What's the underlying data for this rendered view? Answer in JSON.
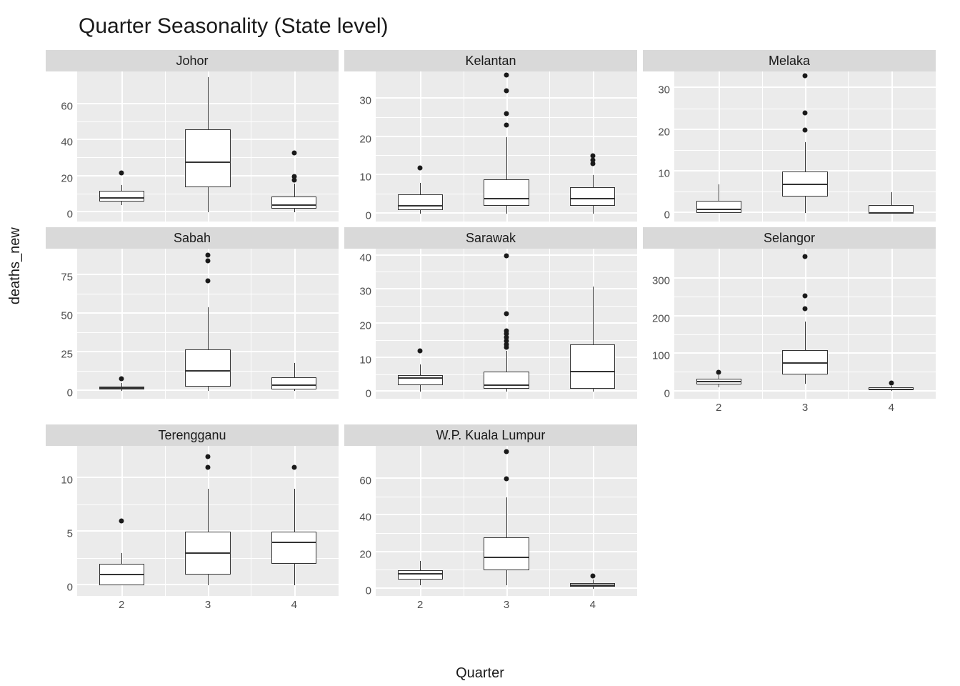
{
  "title": "Quarter Seasonality (State level)",
  "ylabel": "deaths_new",
  "xlabel": "Quarter",
  "categories": [
    "2",
    "3",
    "4"
  ],
  "chart_data": [
    {
      "name": "Johor",
      "ymin": -5,
      "ymax": 78,
      "yticks": [
        0,
        20,
        40,
        60
      ],
      "type": "box",
      "quarters": {
        "2": {
          "ymin": 4,
          "q1": 6,
          "median": 8,
          "q3": 12,
          "ymax": 15,
          "outliers": [
            22
          ]
        },
        "3": {
          "ymin": 0,
          "q1": 14,
          "median": 28,
          "q3": 46,
          "ymax": 75,
          "outliers": []
        },
        "4": {
          "ymin": 0,
          "q1": 2,
          "median": 4,
          "q3": 9,
          "ymax": 16,
          "outliers": [
            18,
            20,
            33
          ]
        }
      }
    },
    {
      "name": "Kelantan",
      "ymin": -2,
      "ymax": 37,
      "yticks": [
        0,
        10,
        20,
        30
      ],
      "type": "box",
      "quarters": {
        "2": {
          "ymin": 0,
          "q1": 1,
          "median": 2,
          "q3": 5,
          "ymax": 8,
          "outliers": [
            12
          ]
        },
        "3": {
          "ymin": 0,
          "q1": 2,
          "median": 4,
          "q3": 9,
          "ymax": 20,
          "outliers": [
            23,
            26,
            32,
            36
          ]
        },
        "4": {
          "ymin": 0,
          "q1": 2,
          "median": 4,
          "q3": 7,
          "ymax": 10,
          "outliers": [
            13,
            14,
            15
          ]
        }
      }
    },
    {
      "name": "Melaka",
      "ymin": -2,
      "ymax": 34,
      "yticks": [
        0,
        10,
        20,
        30
      ],
      "type": "box",
      "quarters": {
        "2": {
          "ymin": 0,
          "q1": 0,
          "median": 1,
          "q3": 3,
          "ymax": 7,
          "outliers": []
        },
        "3": {
          "ymin": 0,
          "q1": 4,
          "median": 7,
          "q3": 10,
          "ymax": 17,
          "outliers": [
            20,
            24,
            33
          ]
        },
        "4": {
          "ymin": 0,
          "q1": 0,
          "median": 0,
          "q3": 2,
          "ymax": 5,
          "outliers": []
        }
      }
    },
    {
      "name": "Sabah",
      "ymin": -5,
      "ymax": 92,
      "yticks": [
        0,
        25,
        50,
        75
      ],
      "type": "box",
      "quarters": {
        "2": {
          "ymin": 0,
          "q1": 1,
          "median": 2,
          "q3": 3,
          "ymax": 5,
          "outliers": [
            8
          ]
        },
        "3": {
          "ymin": 0,
          "q1": 3,
          "median": 13,
          "q3": 27,
          "ymax": 54,
          "outliers": [
            71,
            84,
            88
          ]
        },
        "4": {
          "ymin": 0,
          "q1": 1,
          "median": 4,
          "q3": 9,
          "ymax": 18,
          "outliers": []
        }
      }
    },
    {
      "name": "Sarawak",
      "ymin": -2,
      "ymax": 42,
      "yticks": [
        0,
        10,
        20,
        30,
        40
      ],
      "type": "box",
      "quarters": {
        "2": {
          "ymin": 0,
          "q1": 2,
          "median": 4,
          "q3": 5,
          "ymax": 8,
          "outliers": [
            12
          ]
        },
        "3": {
          "ymin": 0,
          "q1": 1,
          "median": 2,
          "q3": 6,
          "ymax": 12,
          "outliers": [
            13,
            14,
            15,
            16,
            17,
            18,
            23,
            40
          ]
        },
        "4": {
          "ymin": 0,
          "q1": 1,
          "median": 6,
          "q3": 14,
          "ymax": 31,
          "outliers": []
        }
      }
    },
    {
      "name": "Selangor",
      "ymin": -20,
      "ymax": 380,
      "yticks": [
        0,
        100,
        200,
        300
      ],
      "type": "box",
      "quarters": {
        "2": {
          "ymin": 10,
          "q1": 18,
          "median": 25,
          "q3": 34,
          "ymax": 42,
          "outliers": [
            50
          ]
        },
        "3": {
          "ymin": 20,
          "q1": 45,
          "median": 75,
          "q3": 110,
          "ymax": 185,
          "outliers": [
            220,
            255,
            360
          ]
        },
        "4": {
          "ymin": 0,
          "q1": 2,
          "median": 5,
          "q3": 10,
          "ymax": 14,
          "outliers": [
            22
          ]
        }
      }
    },
    {
      "name": "Terengganu",
      "ymin": -1,
      "ymax": 13,
      "yticks": [
        0,
        5,
        10
      ],
      "type": "box",
      "quarters": {
        "2": {
          "ymin": 0,
          "q1": 0,
          "median": 1,
          "q3": 2,
          "ymax": 3,
          "outliers": [
            6
          ]
        },
        "3": {
          "ymin": 0,
          "q1": 1,
          "median": 3,
          "q3": 5,
          "ymax": 9,
          "outliers": [
            11,
            12
          ]
        },
        "4": {
          "ymin": 0,
          "q1": 2,
          "median": 4,
          "q3": 5,
          "ymax": 9,
          "outliers": [
            11
          ]
        }
      }
    },
    {
      "name": "W.P. Kuala Lumpur",
      "ymin": -4,
      "ymax": 78,
      "yticks": [
        0,
        20,
        40,
        60
      ],
      "type": "box",
      "quarters": {
        "2": {
          "ymin": 2,
          "q1": 5,
          "median": 8,
          "q3": 10,
          "ymax": 15,
          "outliers": []
        },
        "3": {
          "ymin": 2,
          "q1": 10,
          "median": 17,
          "q3": 28,
          "ymax": 50,
          "outliers": [
            60,
            75
          ]
        },
        "4": {
          "ymin": 0,
          "q1": 1,
          "median": 2,
          "q3": 3,
          "ymax": 5,
          "outliers": [
            7
          ]
        }
      }
    }
  ]
}
